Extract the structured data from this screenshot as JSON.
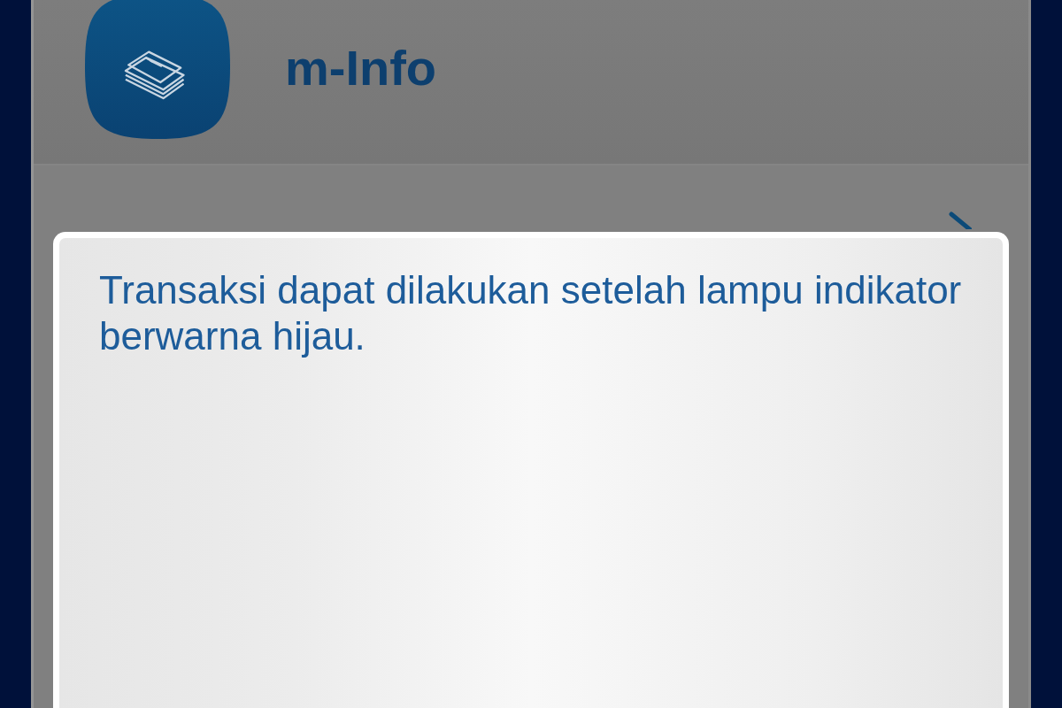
{
  "app_header": {
    "title": "m-Info"
  },
  "dialog": {
    "message": "Transaksi dapat dilakukan setelah lampu indikator berwarna hijau."
  }
}
